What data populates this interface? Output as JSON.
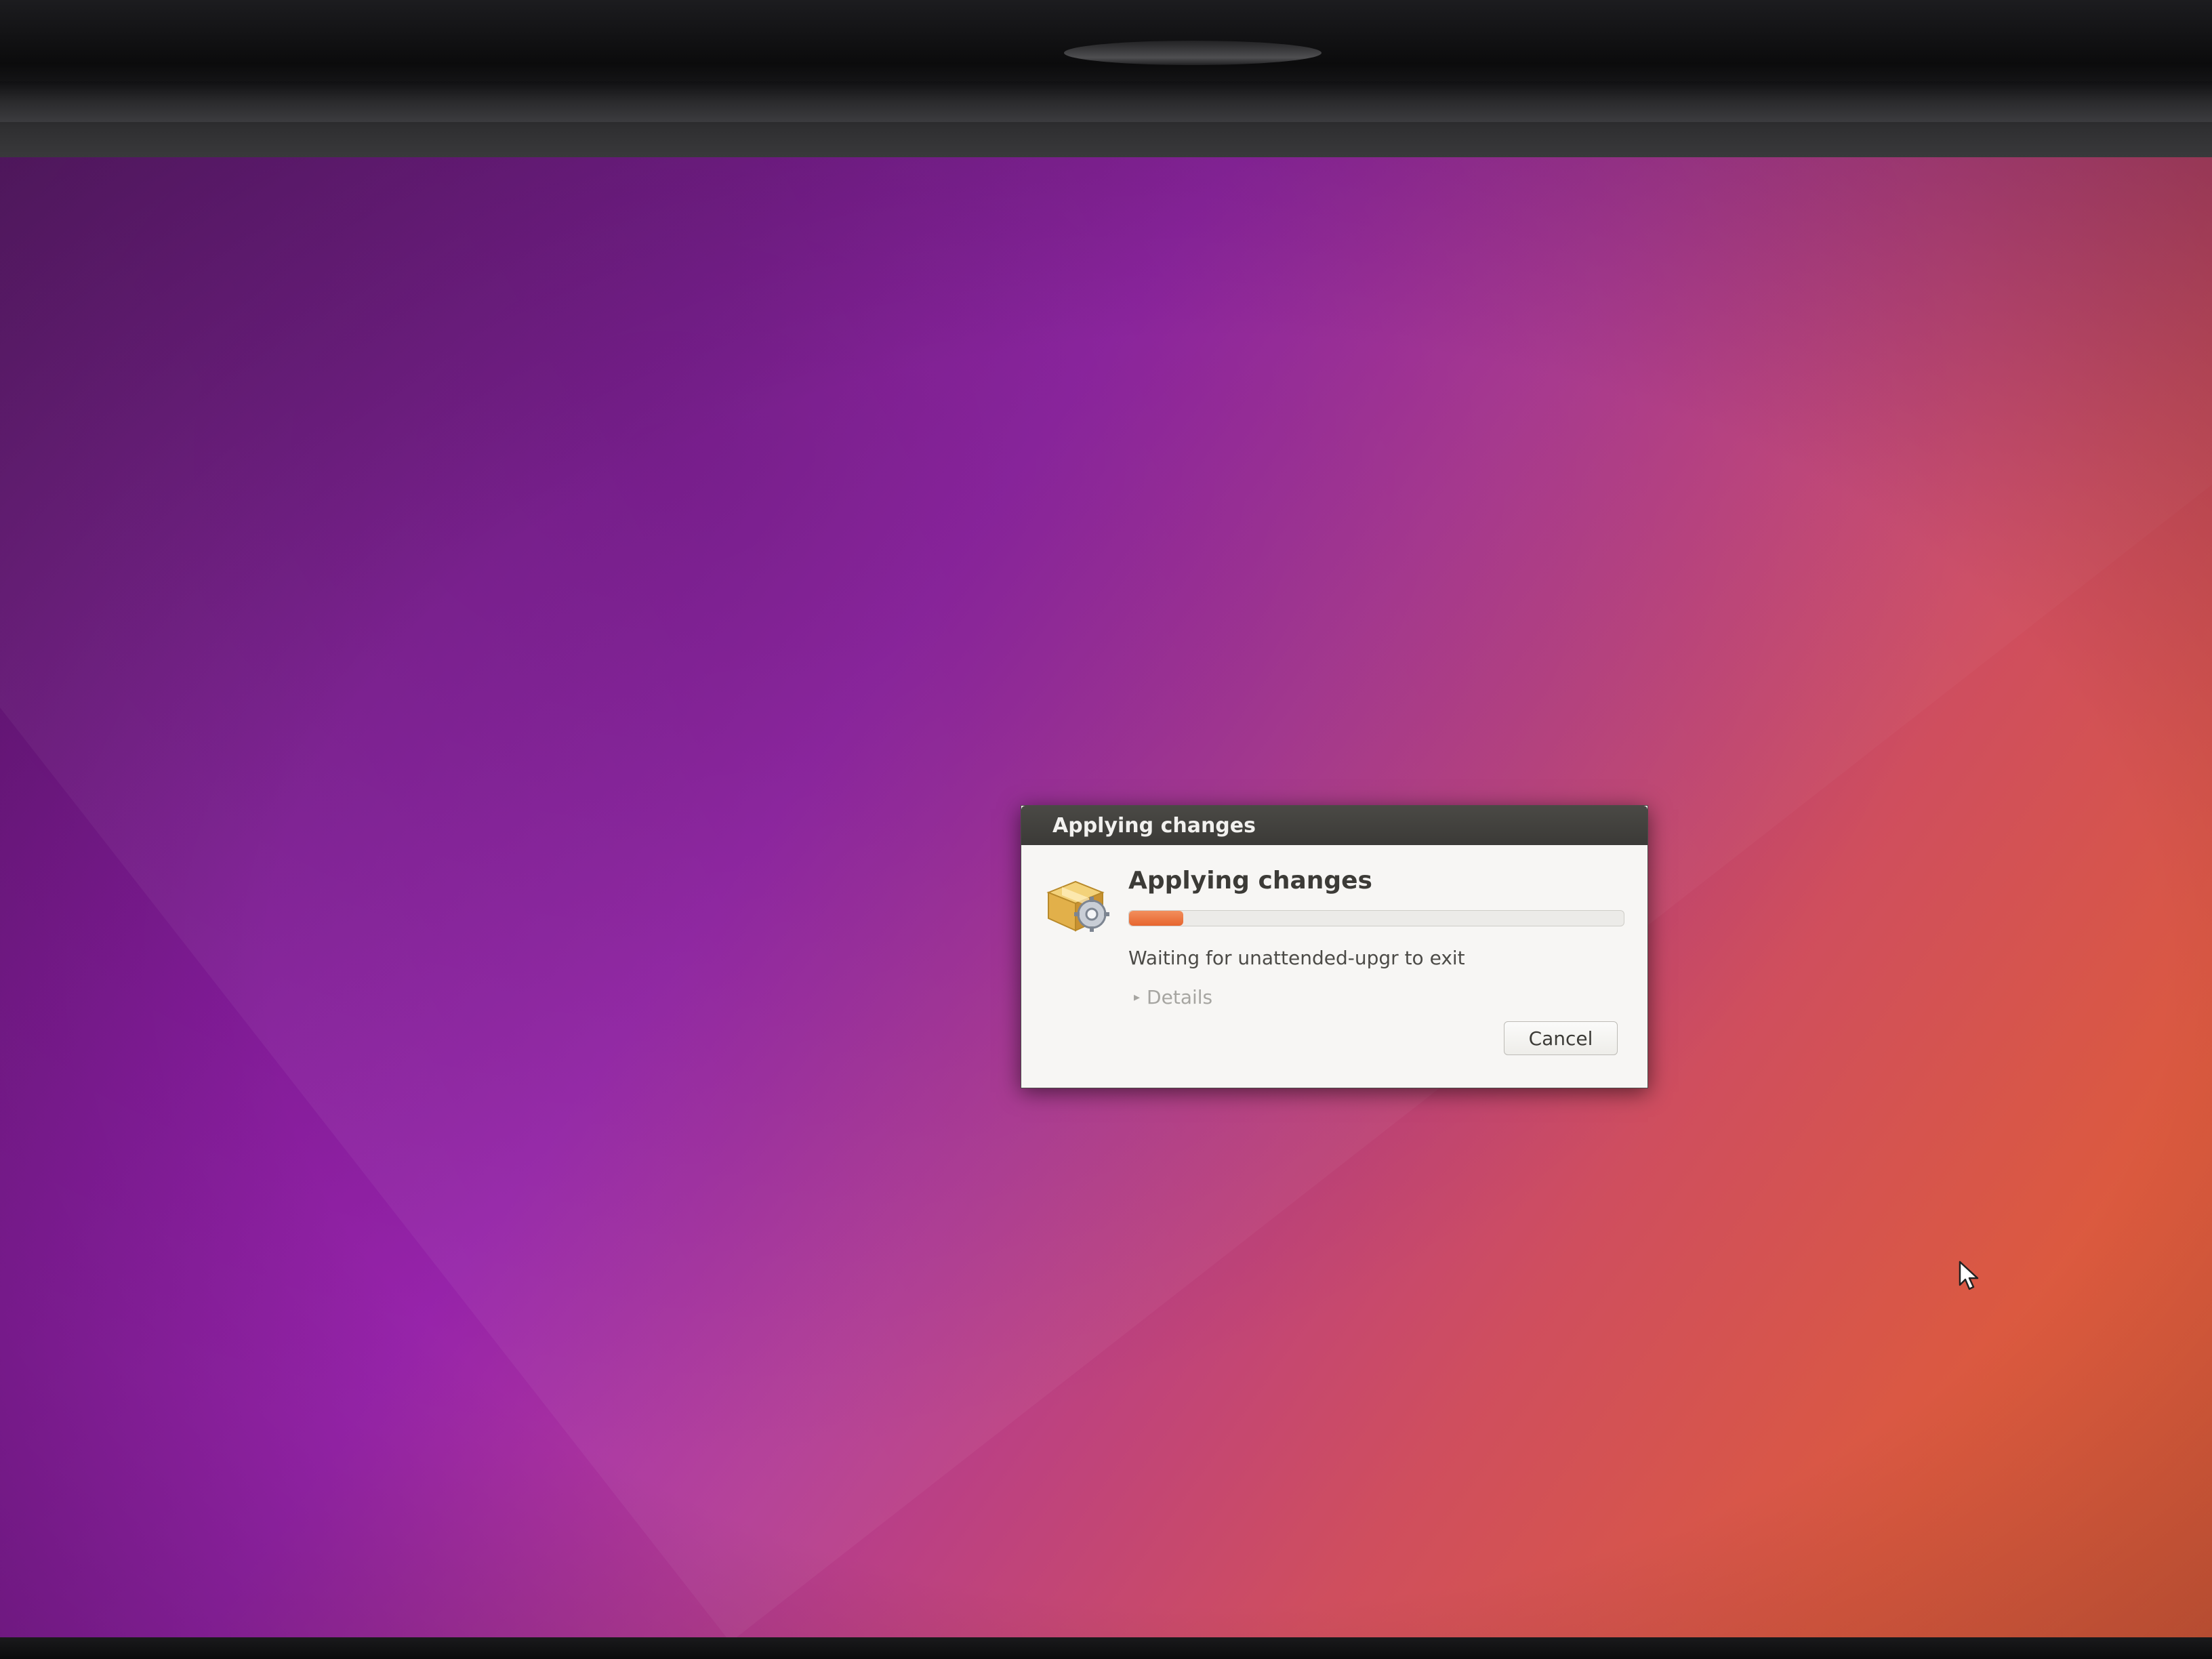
{
  "dialog": {
    "window_title": "Applying changes",
    "heading": "Applying changes",
    "progress": 0.11,
    "status": "Waiting for unattended-upgr to exit",
    "details_label": "Details",
    "details_arrow": "▸",
    "cancel_label": "Cancel",
    "icon": "package-installer-icon"
  },
  "colors": {
    "accent_progress": "#e7652f",
    "titlebar": "#3b3a37",
    "dialog_bg": "#f7f6f4",
    "wallpaper_purple": "#8a1fa0",
    "wallpaper_orange": "#dc5a3e"
  },
  "cursor": {
    "icon": "mouse-pointer-icon"
  }
}
